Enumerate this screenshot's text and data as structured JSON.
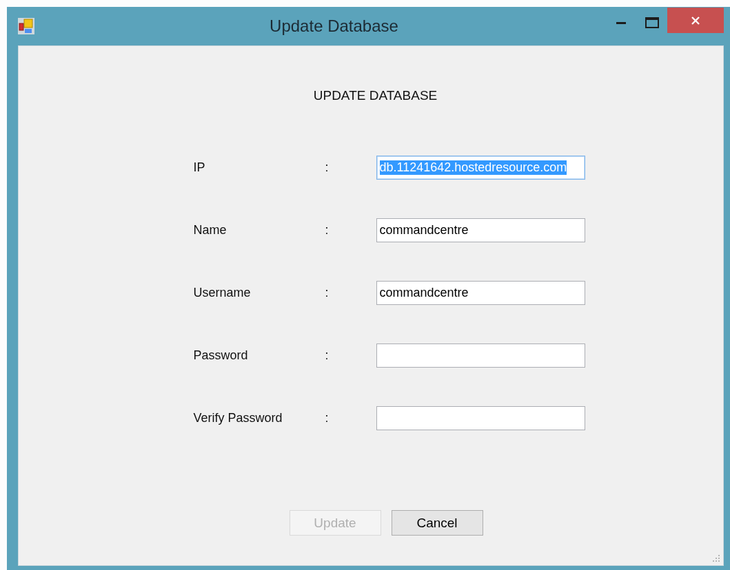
{
  "window": {
    "title": "Update Database"
  },
  "heading": "UPDATE DATABASE",
  "fields": [
    {
      "label": "IP",
      "separator": ":",
      "value": "db.11241642.hostedresource.com",
      "focused": true
    },
    {
      "label": "Name",
      "separator": ":",
      "value": "commandcentre",
      "focused": false
    },
    {
      "label": "Username",
      "separator": ":",
      "value": "commandcentre",
      "focused": false
    },
    {
      "label": "Password",
      "separator": ":",
      "focused": false
    },
    {
      "label": "Verify Password",
      "separator": ":",
      "focused": false
    }
  ],
  "buttons": [
    {
      "label": "Update",
      "disabled": true
    },
    {
      "label": "Cancel",
      "disabled": false
    }
  ]
}
